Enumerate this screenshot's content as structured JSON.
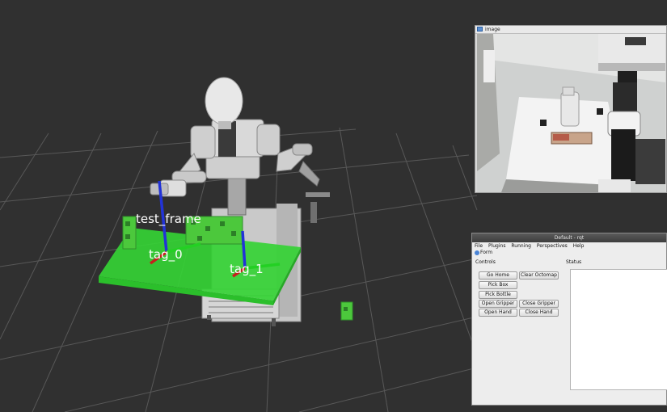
{
  "scene": {
    "labels": {
      "tag0": "tag_0",
      "tag1": "tag_1",
      "test_frame": "test_frame"
    }
  },
  "image_window": {
    "title": "image"
  },
  "rqt": {
    "title": "Default - rqt",
    "menu": [
      "File",
      "Plugins",
      "Running",
      "Perspectives",
      "Help"
    ],
    "form_label": "Form",
    "controls_label": "Controls",
    "status_label": "Status",
    "buttons": {
      "go_home": "Go Home",
      "clear_octomap": "Clear Octomap",
      "pick_box": "Pick Box",
      "pick_bottle": "Pick Bottle",
      "open_gripper": "Open Gripper",
      "close_gripper": "Close Gripper",
      "open_hand": "Open Hand",
      "close_hand": "Close Hand"
    }
  },
  "colors": {
    "grid_bg": "#303030",
    "grid_line": "#5a5a5a",
    "table_green": "#3ddc3d",
    "marker_green": "#48c83c"
  }
}
